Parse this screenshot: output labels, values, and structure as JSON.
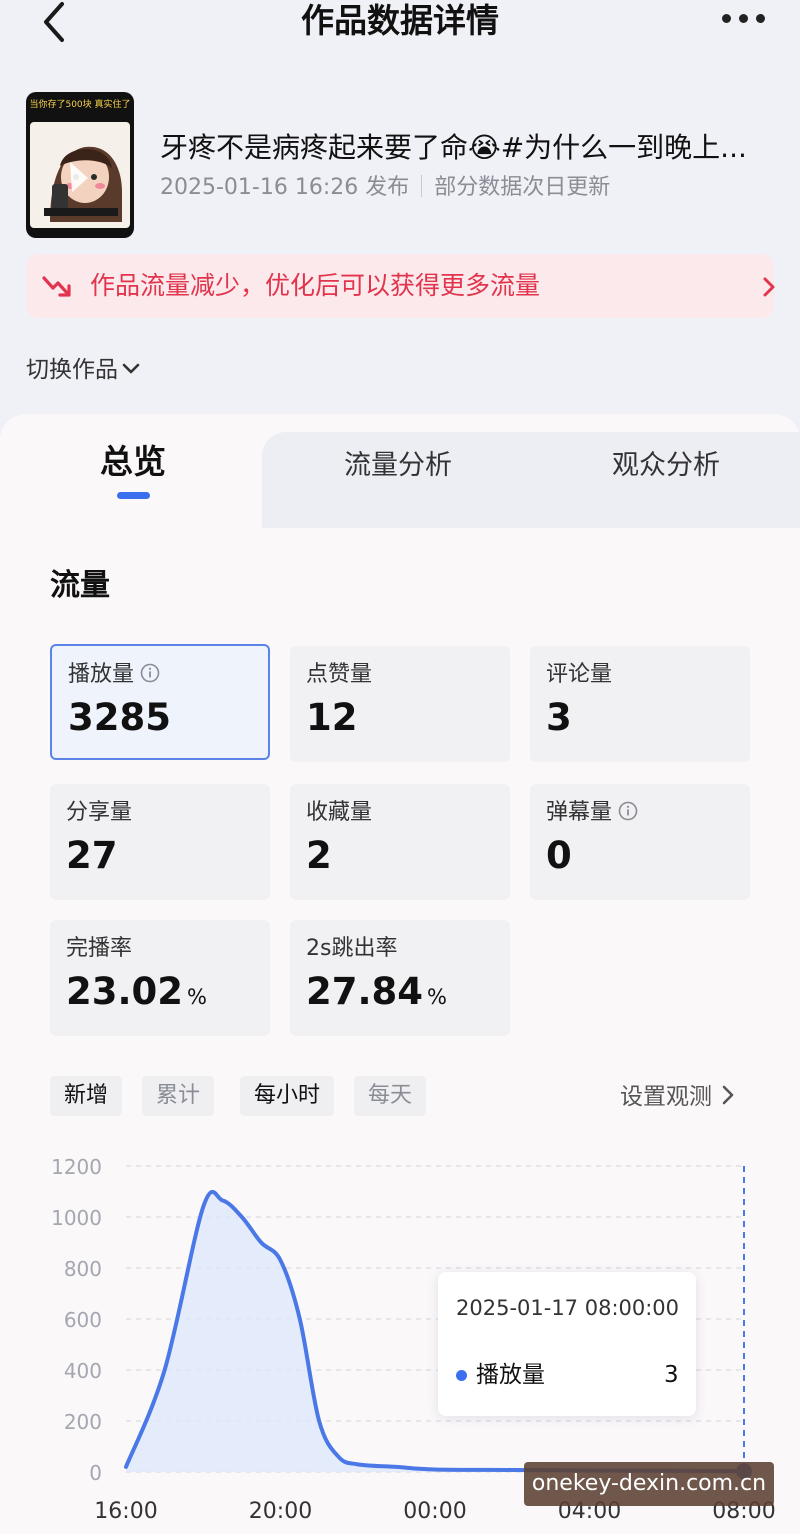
{
  "header": {
    "title": "作品数据详情"
  },
  "work": {
    "title": "牙疼不是病疼起来要了命😭#为什么一到晚上...",
    "publish_time": "2025-01-16 16:26 发布",
    "update_note": "部分数据次日更新",
    "thumbnail_caption": "当你存了500块 真实住了"
  },
  "alert": {
    "text": "作品流量减少，优化后可以获得更多流量"
  },
  "switch_label": "切换作品",
  "tabs": [
    {
      "label": "总览",
      "active": true
    },
    {
      "label": "流量分析",
      "active": false
    },
    {
      "label": "观众分析",
      "active": false
    }
  ],
  "section_title": "流量",
  "metrics": [
    {
      "label": "播放量",
      "value": "3285",
      "unit": "",
      "info": true,
      "selected": true
    },
    {
      "label": "点赞量",
      "value": "12",
      "unit": ""
    },
    {
      "label": "评论量",
      "value": "3",
      "unit": ""
    },
    {
      "label": "分享量",
      "value": "27",
      "unit": ""
    },
    {
      "label": "收藏量",
      "value": "2",
      "unit": ""
    },
    {
      "label": "弹幕量",
      "value": "0",
      "unit": "",
      "info": true
    },
    {
      "label": "完播率",
      "value": "23.02",
      "unit": "%"
    },
    {
      "label": "2s跳出率",
      "value": "27.84",
      "unit": "%"
    }
  ],
  "chips": [
    "新增",
    "累计",
    "每小时",
    "每天"
  ],
  "observe_label": "设置观测",
  "chart_data": {
    "type": "area",
    "y_ticks": [
      "1200",
      "1000",
      "800",
      "600",
      "400",
      "200",
      "0"
    ],
    "ylim": [
      0,
      1200
    ],
    "x_tick_labels": [
      "16:00",
      "20:00",
      "00:00",
      "04:00",
      "08:00"
    ],
    "x_hours": [
      16,
      17,
      18,
      18.5,
      19,
      19.5,
      20,
      20.5,
      21,
      21.5,
      22,
      23,
      0,
      2,
      4,
      6,
      8
    ],
    "series": [
      {
        "name": "播放量",
        "values": [
          20,
          400,
          1040,
          1065,
          1000,
          900,
          830,
          600,
          200,
          60,
          30,
          20,
          10,
          8,
          6,
          5,
          3
        ]
      }
    ],
    "colors": {
      "line": "#4a78e6",
      "fill": "#dfe7fb"
    },
    "grid": true
  },
  "tooltip": {
    "time": "2025-01-17 08:00:00",
    "series_name": "播放量",
    "value": "3"
  },
  "watermark": "onekey-dexin.com.cn"
}
